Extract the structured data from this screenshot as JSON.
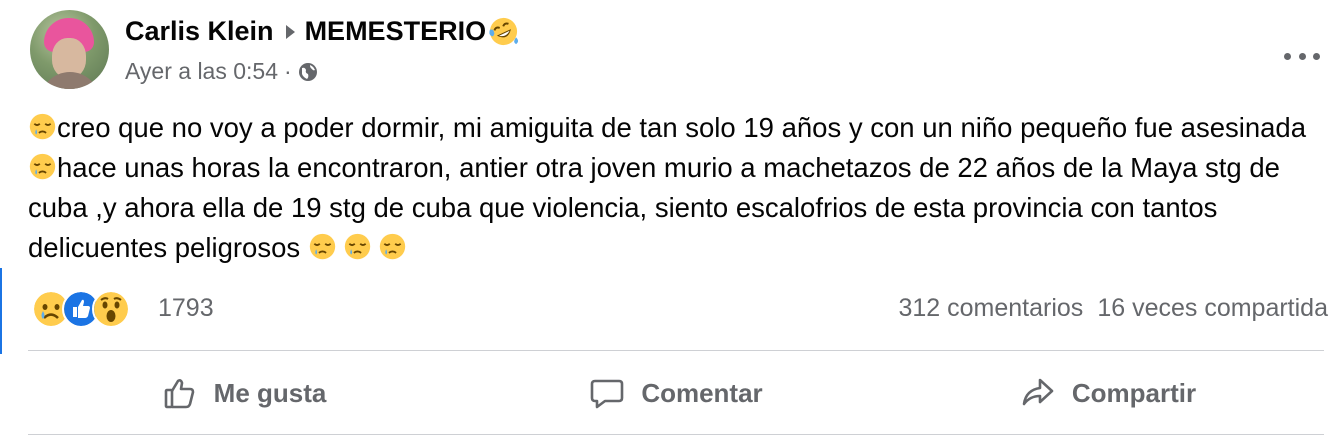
{
  "post": {
    "author": "Carlis Klein",
    "group": "MEMESTERIO",
    "group_emoji": "rofl-emoji",
    "timestamp": "Ayer a las 0:54",
    "separator": "·",
    "privacy_icon": "globe-icon",
    "menu_icon": "more-options-icon",
    "text_segments": [
      "creo que no voy a poder dormir, mi amiguita de tan solo 19 años y con un niño pequeño fue asesinada",
      "hace unas horas la encontraron, antier otra joven murio a machetazos de 22 años de la Maya stg de cuba ,y ahora ella de 19 stg de cuba que violencia, siento escalofrios de esta provincia con tantos delicuentes peligrosos "
    ],
    "text_emoji": "sleepy-face-emoji"
  },
  "reactions": {
    "icons": [
      "sad-reaction-icon",
      "like-reaction-icon",
      "wow-reaction-icon"
    ],
    "count": "1793",
    "comments": "312 comentarios",
    "shares": "16 veces compartida"
  },
  "actions": {
    "like": "Me gusta",
    "comment": "Comentar",
    "share": "Compartir"
  },
  "colors": {
    "text": "#050505",
    "secondary": "#65676b",
    "divider": "#ced0d4",
    "like_blue": "#1b74e4",
    "emoji_yellow": "#ffcc4d"
  }
}
